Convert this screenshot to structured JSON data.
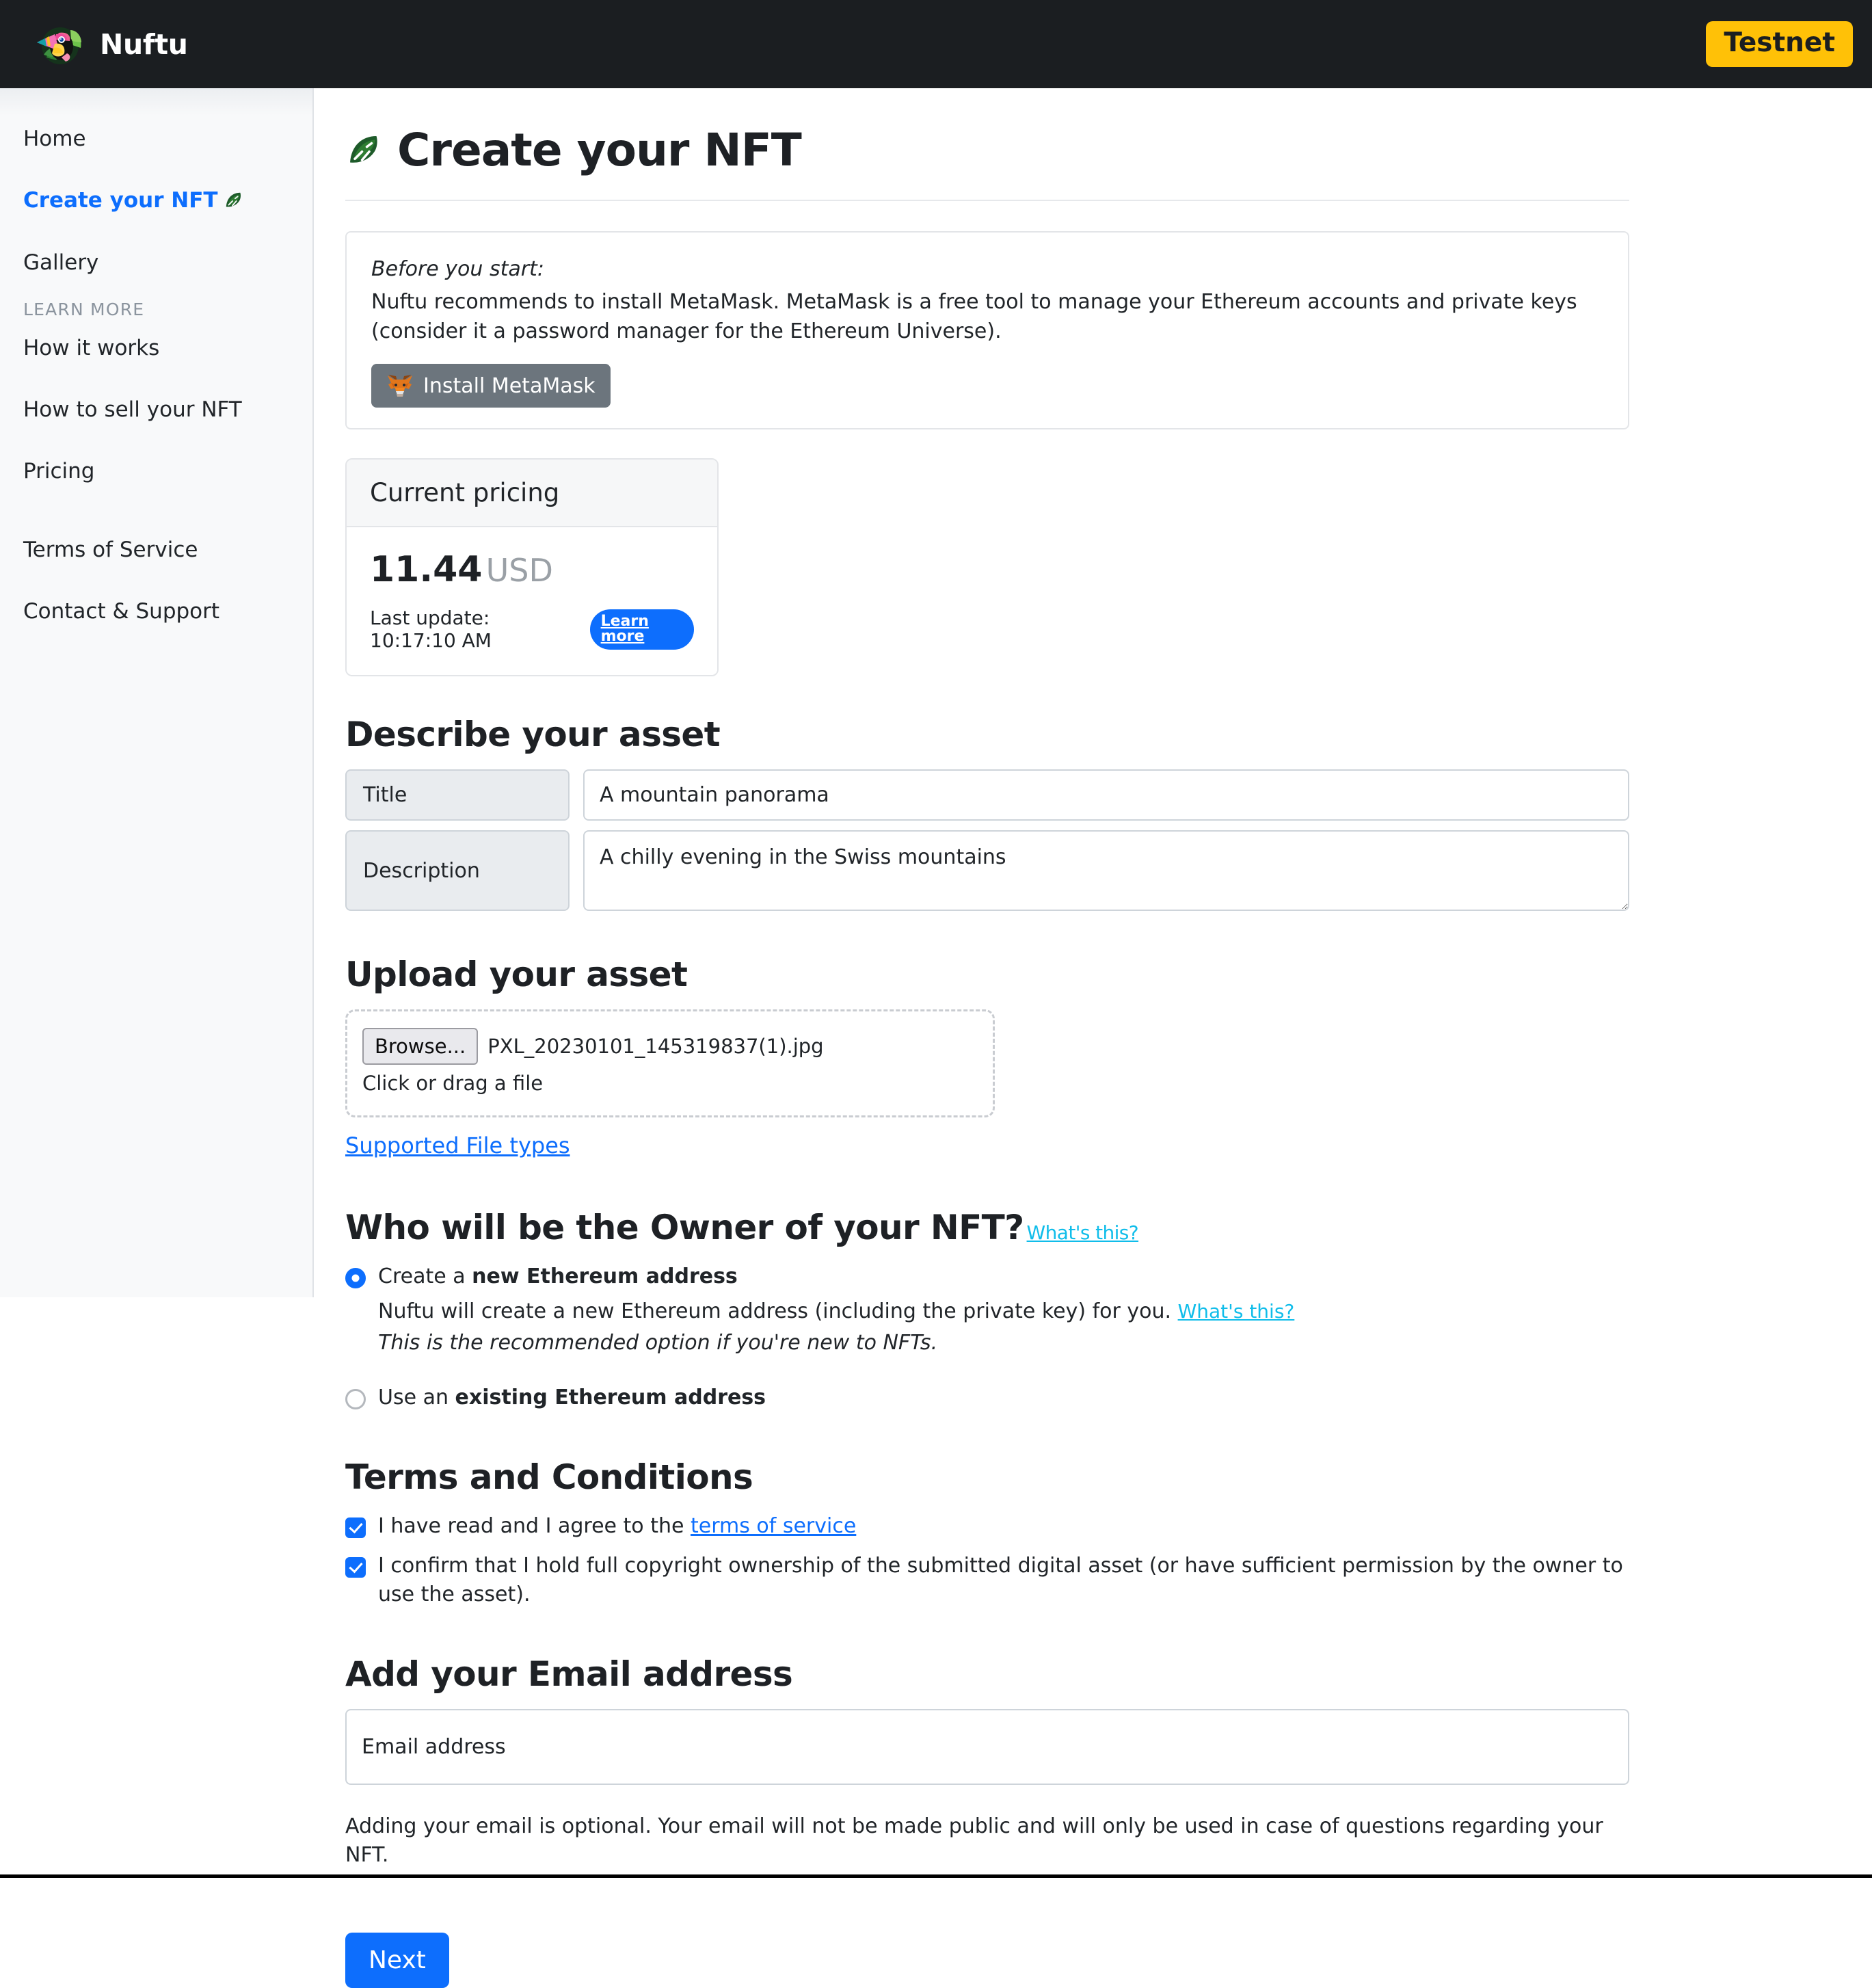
{
  "brand": {
    "name": "Nuftu",
    "logo_icon": "toucan-logo-icon"
  },
  "topbar": {
    "network_badge": "Testnet"
  },
  "sidebar": {
    "primary": [
      {
        "label": "Home",
        "active": false
      },
      {
        "label": "Create your NFT",
        "active": true,
        "trailing_icon": "leaf-icon"
      },
      {
        "label": "Gallery",
        "active": false
      }
    ],
    "section_title": "LEARN MORE",
    "learn_more": [
      {
        "label": "How it works"
      },
      {
        "label": "How to sell your NFT"
      },
      {
        "label": "Pricing"
      }
    ],
    "footer_links": [
      {
        "label": "Terms of Service"
      },
      {
        "label": "Contact & Support"
      }
    ]
  },
  "page": {
    "title": "Create your NFT",
    "title_icon": "leaf-icon"
  },
  "notice": {
    "label": "Before you start:",
    "text": "Nuftu recommends to install MetaMask. MetaMask is a free tool to manage your Ethereum accounts and private keys (consider it a password manager for the Ethereum Universe).",
    "button_label": "Install MetaMask",
    "button_icon": "metamask-fox-icon"
  },
  "pricing": {
    "header": "Current pricing",
    "value": "11.44",
    "currency": "USD",
    "last_update": "Last update: 10:17:10 AM",
    "learn_more_badge": "Learn more"
  },
  "describe": {
    "heading": "Describe your asset",
    "title_label": "Title",
    "title_value": "A mountain panorama",
    "description_label": "Description",
    "description_value": "A chilly evening in the Swiss mountains"
  },
  "upload": {
    "heading": "Upload your asset",
    "browse_label": "Browse...",
    "file_name": "PXL_20230101_145319837(1).jpg",
    "drop_hint": "Click or drag a file",
    "supported_link": "Supported File types"
  },
  "owner": {
    "heading": "Who will be the Owner of your NFT?",
    "heading_link": "What's this?",
    "option_new_prefix": "Create a ",
    "option_new_strong": "new Ethereum address",
    "option_new_desc": "Nuftu will create a new Ethereum address (including the private key) for you. ",
    "option_new_desc_link": "What's this?",
    "option_new_note": "This is the recommended option if you're new to NFTs.",
    "option_existing_prefix": "Use an ",
    "option_existing_strong": "existing Ethereum address"
  },
  "terms": {
    "heading": "Terms and Conditions",
    "agree_prefix": "I have read and I agree to the ",
    "agree_link": "terms of service",
    "copyright_text": "I confirm that I hold full copyright ownership of the submitted digital asset (or have sufficient permission by the owner to use the asset)."
  },
  "email": {
    "heading": "Add your Email address",
    "placeholder": "Email address",
    "value": "",
    "note": "Adding your email is optional. Your email will not be made public and will only be used in case of questions regarding your NFT."
  },
  "actions": {
    "next_label": "Next"
  },
  "colors": {
    "accent_blue": "#0d6efd",
    "testnet_yellow": "#ffc107",
    "link_cyan": "#10bdea",
    "topbar_dark": "#1b1e21",
    "sidebar_bg": "#f8f9fa",
    "metamask_gray": "#6c757d"
  }
}
